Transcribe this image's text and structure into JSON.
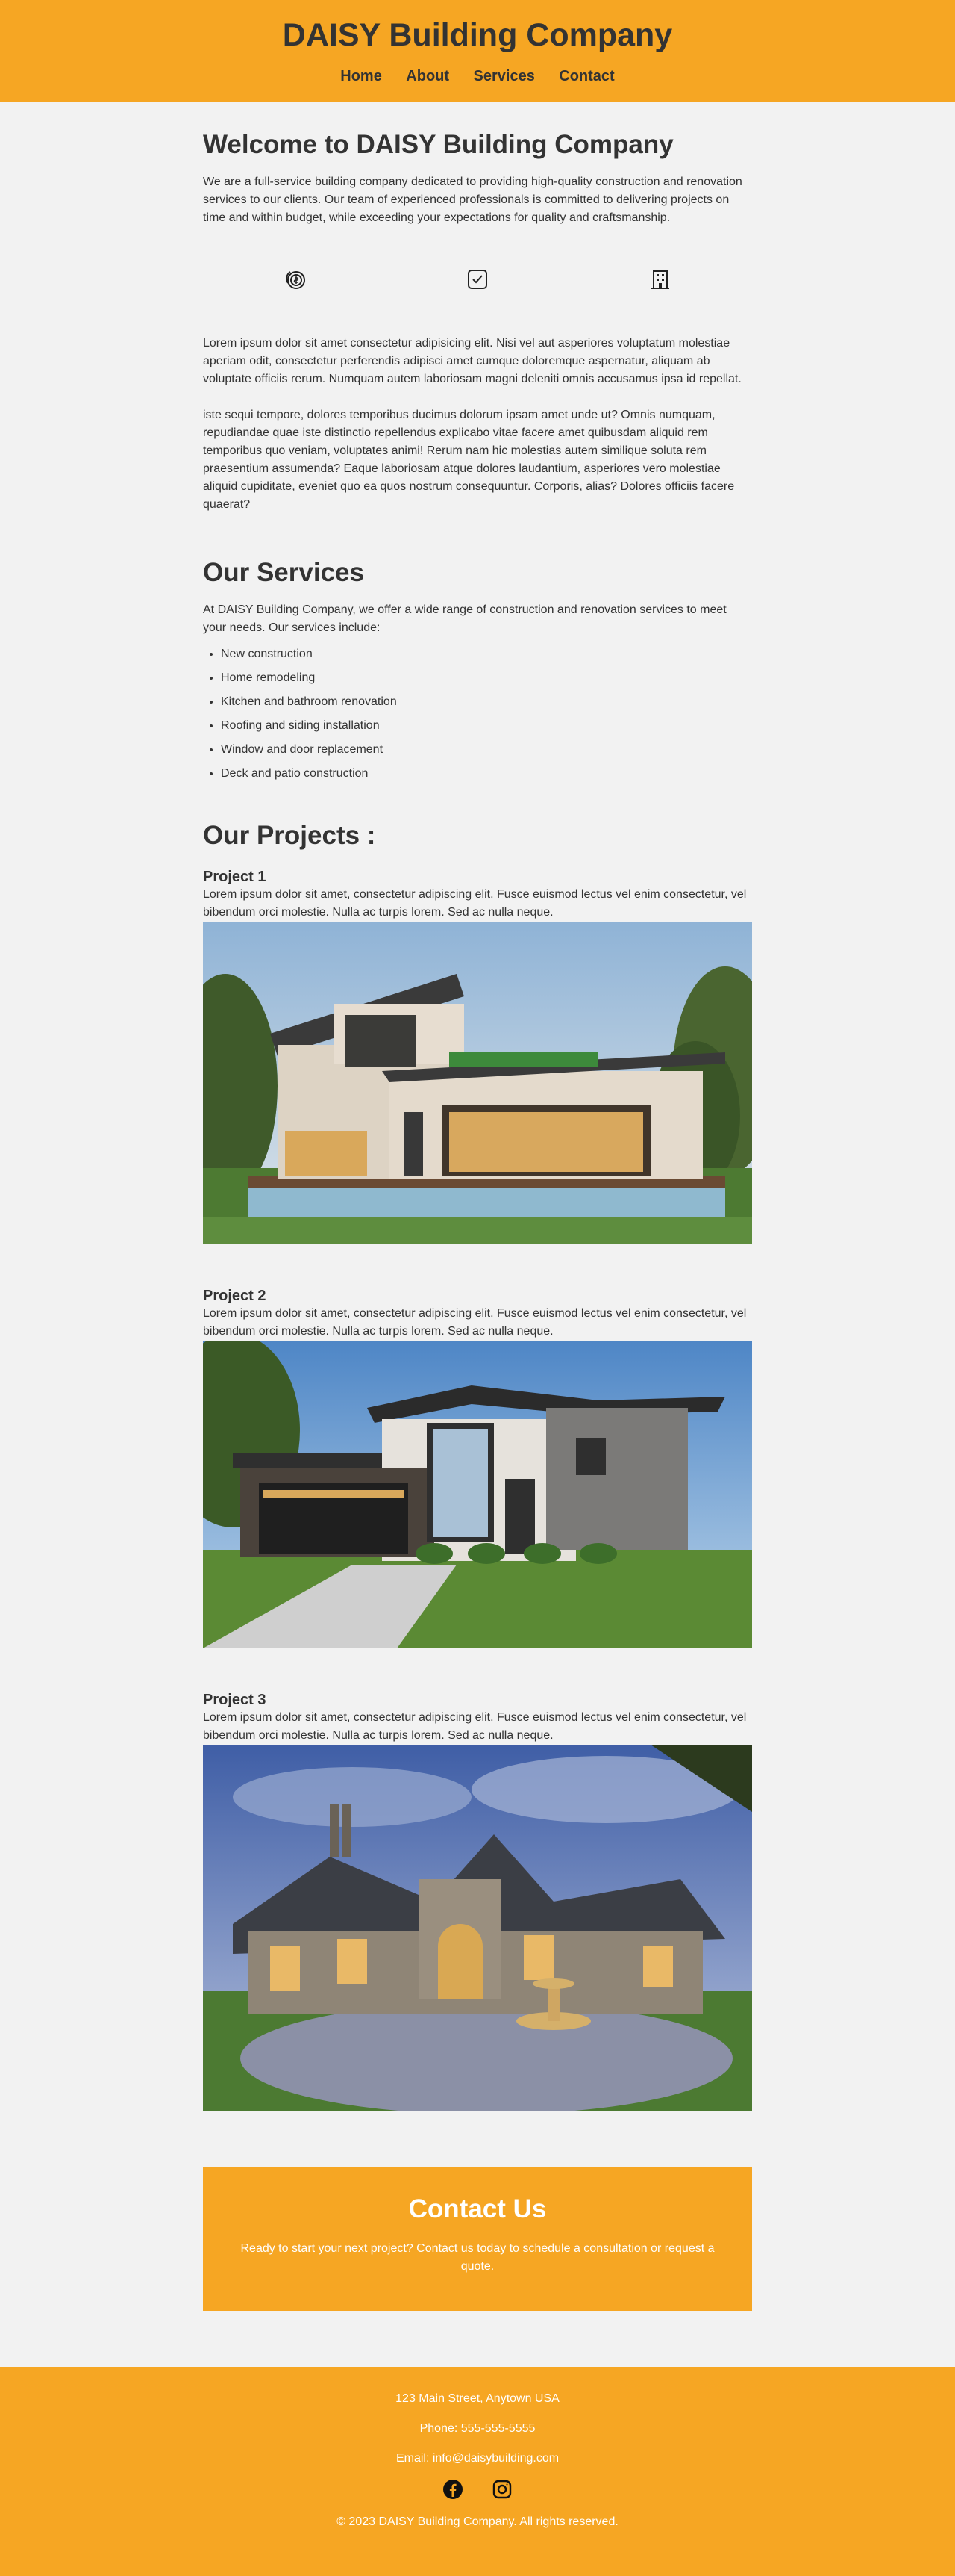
{
  "header": {
    "title": "DAISY Building Company",
    "nav": [
      "Home",
      "About",
      "Services",
      "Contact"
    ]
  },
  "welcome": {
    "title": "Welcome to DAISY Building Company",
    "text": "We are a full-service building company dedicated to providing high-quality construction and renovation services to our clients. Our team of experienced professionals is committed to delivering projects on time and within budget, while exceeding your expectations for quality and craftsmanship.",
    "icons": [
      "coins-icon",
      "checkbox-icon",
      "building-icon"
    ],
    "lorem1": "Lorem ipsum dolor sit amet consectetur adipisicing elit. Nisi vel aut asperiores voluptatum molestiae aperiam odit, consectetur perferendis adipisci amet cumque doloremque aspernatur, aliquam ab voluptate officiis rerum. Numquam autem laboriosam magni deleniti omnis accusamus ipsa id repellat.",
    "lorem2": "iste sequi tempore, dolores temporibus ducimus dolorum ipsam amet unde ut? Omnis numquam, repudiandae quae iste distinctio repellendus explicabo vitae facere amet quibusdam aliquid rem temporibus quo veniam, voluptates animi! Rerum nam hic molestias autem similique soluta rem praesentium assumenda? Eaque laboriosam atque dolores laudantium, asperiores vero molestiae aliquid cupiditate, eveniet quo ea quos nostrum consequuntur. Corporis, alias? Dolores officiis facere quaerat?"
  },
  "services": {
    "title": "Our Services",
    "intro": "At DAISY Building Company, we offer a wide range of construction and renovation services to meet your needs. Our services include:",
    "items": [
      "New construction",
      "Home remodeling",
      "Kitchen and bathroom renovation",
      "Roofing and siding installation",
      "Window and door replacement",
      "Deck and patio construction"
    ]
  },
  "projects": {
    "title": "Our Projects :",
    "items": [
      {
        "name": "Project 1",
        "text": "Lorem ipsum dolor sit amet, consectetur adipiscing elit. Fusce euismod lectus vel enim consectetur, vel bibendum orci molestie. Nulla ac turpis lorem. Sed ac nulla neque."
      },
      {
        "name": "Project 2",
        "text": "Lorem ipsum dolor sit amet, consectetur adipiscing elit. Fusce euismod lectus vel enim consectetur, vel bibendum orci molestie. Nulla ac turpis lorem. Sed ac nulla neque."
      },
      {
        "name": "Project 3",
        "text": "Lorem ipsum dolor sit amet, consectetur adipiscing elit. Fusce euismod lectus vel enim consectetur, vel bibendum orci molestie. Nulla ac turpis lorem. Sed ac nulla neque."
      }
    ]
  },
  "contact": {
    "title": "Contact Us",
    "text": "Ready to start your next project? Contact us today to schedule a consultation or request a quote."
  },
  "footer": {
    "address": "123 Main Street, Anytown USA",
    "phone": "Phone: 555-555-5555",
    "email": "Email: info@daisybuilding.com",
    "social_icons": [
      "facebook-icon",
      "instagram-icon"
    ],
    "copyright": "© 2023 DAISY Building Company. All rights reserved."
  },
  "colors": {
    "brand": "#f6a623",
    "background": "#f2f2f2",
    "text": "#333333"
  }
}
